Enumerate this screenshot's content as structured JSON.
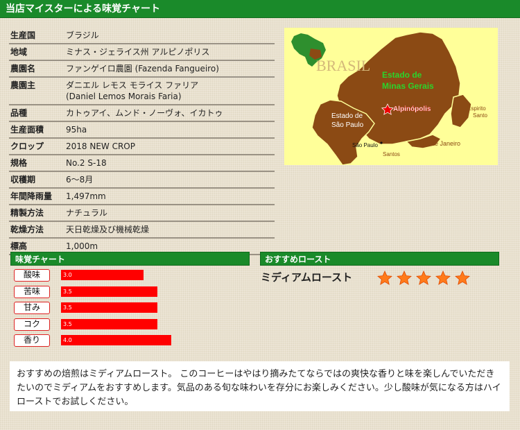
{
  "header": {
    "title": "当店マイスターによる味覚チャート"
  },
  "specs": [
    {
      "key": "生産国",
      "value": "ブラジル"
    },
    {
      "key": "地域",
      "value": "ミナス・ジェライス州 アルピノポリス"
    },
    {
      "key": "農園名",
      "value": "ファンゲイロ農園 (Fazenda Fangueiro)"
    },
    {
      "key": "農園主",
      "value": "ダニエル レモス モライス ファリア\n(Daniel Lemos Morais Faria)"
    },
    {
      "key": "品種",
      "value": "カトゥアイ、ムンド・ノーヴォ、イカトゥ"
    },
    {
      "key": "生産面積",
      "value": "95ha"
    },
    {
      "key": "クロップ",
      "value": "2018 NEW CROP"
    },
    {
      "key": "規格",
      "value": "No.2 S-18"
    },
    {
      "key": "収穫期",
      "value": "6～8月"
    },
    {
      "key": "年間降雨量",
      "value": "1,497mm"
    },
    {
      "key": "精製方法",
      "value": "ナチュラル"
    },
    {
      "key": "乾燥方法",
      "value": "天日乾燥及び機械乾燥"
    },
    {
      "key": "標高",
      "value": "1,000m"
    }
  ],
  "map": {
    "country": "BRASIL",
    "state_label_1": "Estado de",
    "state_label_2": "Minas Gerais",
    "sp_label_1": "Estado de",
    "sp_label_2": "São Paulo",
    "city": "Alpinópolis",
    "sao_paulo_city": "São Paulo",
    "santos": "Santos",
    "rio": "Rio de Janeiro",
    "espirito_1": "Espirito",
    "espirito_2": "Santo",
    "colors": {
      "land": "#8b4a14",
      "bg": "#ffff99",
      "state_text": "#2bd42b",
      "city": "#e00000"
    }
  },
  "taste": {
    "heading": "味覚チャート",
    "max": 5,
    "items": [
      {
        "label": "酸味",
        "value": 3.0,
        "value_text": "3.0"
      },
      {
        "label": "苦味",
        "value": 3.5,
        "value_text": "3.5"
      },
      {
        "label": "甘み",
        "value": 3.5,
        "value_text": "3.5"
      },
      {
        "label": "コク",
        "value": 3.5,
        "value_text": "3.5"
      },
      {
        "label": "香り",
        "value": 4.0,
        "value_text": "4.0"
      }
    ]
  },
  "roast": {
    "heading": "おすすめロースト",
    "label": "ミディアムロースト",
    "stars": 5
  },
  "comment": "おすすめの焙煎はミディアムロースト。 このコーヒーはやはり摘みたてならではの爽快な香りと味を楽しんでいただきたいのでミディアムをおすすめします。気品のある旬な味わいを存分にお楽しみください。少し酸味が気になる方はハイローストでお試しください。"
}
